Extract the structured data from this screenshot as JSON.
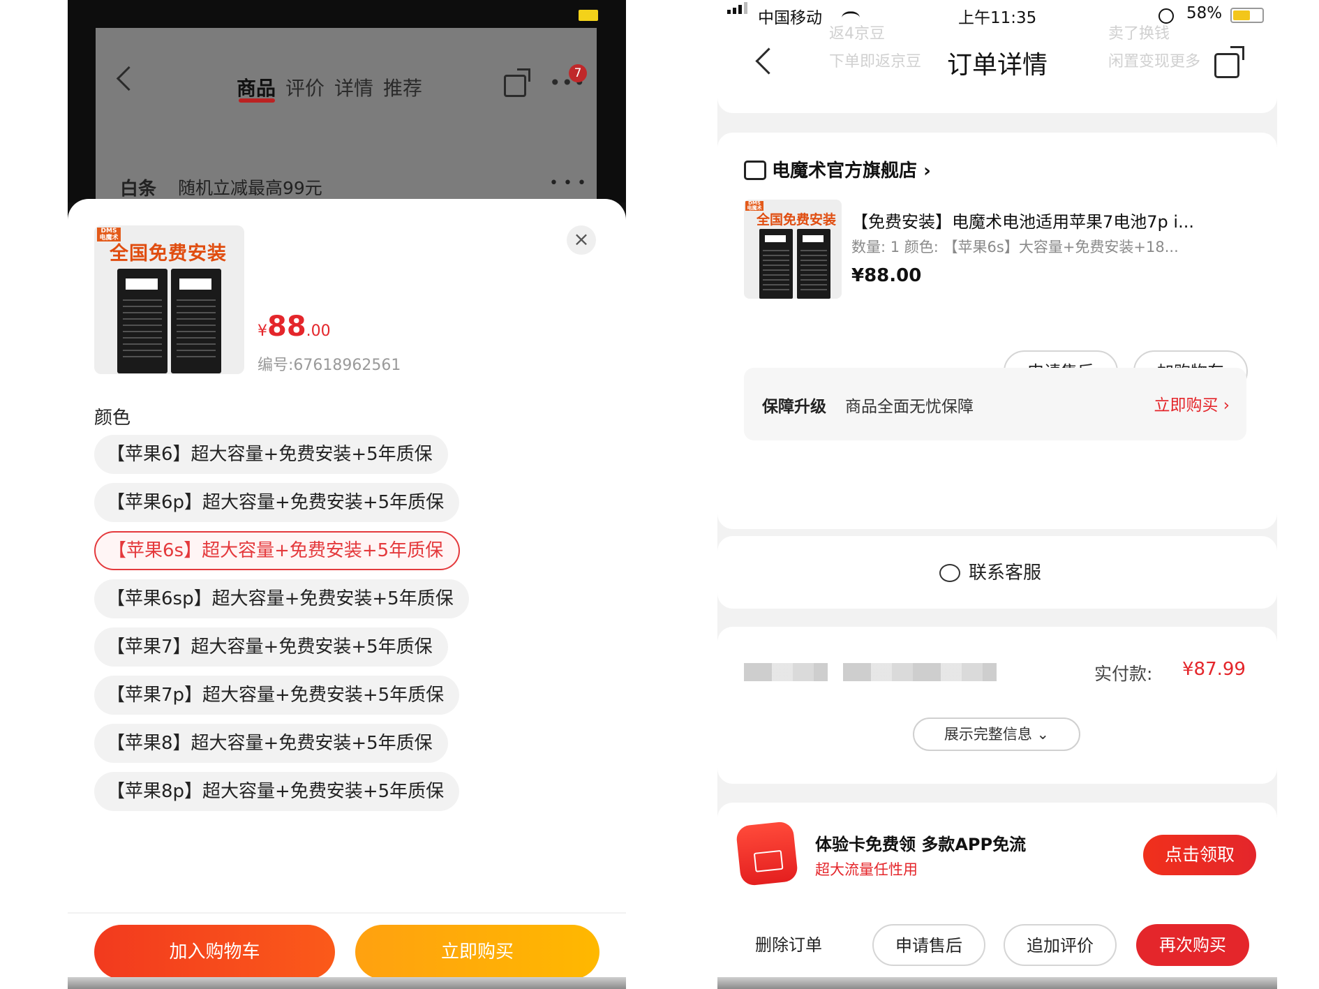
{
  "left": {
    "tabs": [
      {
        "label": "商品",
        "active": true
      },
      {
        "label": "评价"
      },
      {
        "label": "详情"
      },
      {
        "label": "推荐"
      }
    ],
    "badge_count": "7",
    "more_label": "•••",
    "baitiao": {
      "label": "白条",
      "text": "随机立减最高99元",
      "dots": "• • •"
    },
    "product": {
      "image_promo": "全国免费安装",
      "image_brand": "DMS 电魔术",
      "price_symbol": "¥",
      "price_int": "88",
      "price_dec": ".00",
      "sku": "编号:67618962561"
    },
    "close_icon": "×",
    "color_title": "颜色",
    "options": [
      {
        "label": "【苹果6】超大容量+免费安装+5年质保"
      },
      {
        "label": "【苹果6p】超大容量+免费安装+5年质保"
      },
      {
        "label": "【苹果6s】超大容量+免费安装+5年质保",
        "selected": true
      },
      {
        "label": "【苹果6sp】超大容量+免费安装+5年质保"
      },
      {
        "label": "【苹果7】超大容量+免费安装+5年质保"
      },
      {
        "label": "【苹果7p】超大容量+免费安装+5年质保"
      },
      {
        "label": "【苹果8】超大容量+免费安装+5年质保"
      },
      {
        "label": "【苹果8p】超大容量+免费安装+5年质保"
      }
    ],
    "add_to_cart": "加入购物车",
    "buy_now": "立即购买"
  },
  "right": {
    "status": {
      "carrier": "中国移动",
      "time": "上午11:35",
      "battery": "58%"
    },
    "ghost": {
      "a": "返4京豆",
      "b": "下单即返京豆",
      "c": "卖了换钱",
      "d": "闲置变现更多"
    },
    "title": "订单详情",
    "store": {
      "name": "电魔术官方旗舰店",
      "chevron": "›"
    },
    "item": {
      "image_promo": "全国免费安装",
      "image_brand": "DMS 电魔术",
      "title": "【免费安装】电魔术电池适用苹果7电池7p i...",
      "attr": "数量: 1  颜色: 【苹果6s】大容量+免费安装+18...",
      "price": "¥88.00"
    },
    "after_sale": "申请售后",
    "add_cart": "加购物车",
    "guarantee": {
      "label": "保障升级",
      "text": "商品全面无忧保障",
      "link": "立即购买 ›"
    },
    "service": "联系客服",
    "paid": {
      "label": "实付款:",
      "value": "¥87.99"
    },
    "expand": "展示完整信息 ⌄",
    "promo": {
      "title": "体验卡免费领 多款APP免流",
      "sub": "超大流量任性用",
      "button": "点击领取"
    },
    "bottom": {
      "delete": "删除订单",
      "after_sale": "申请售后",
      "review": "追加评价",
      "rebuy": "再次购买"
    }
  }
}
